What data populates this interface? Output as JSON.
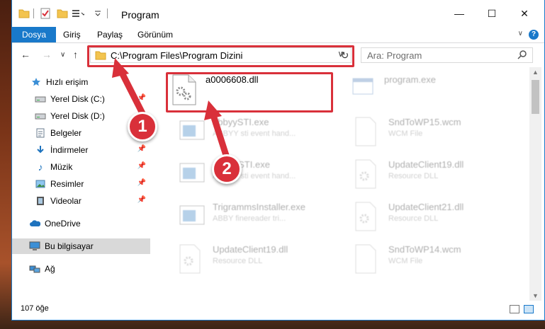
{
  "window": {
    "title": "Program",
    "minimize": "—",
    "maximize": "☐",
    "close": "✕"
  },
  "ribbon": {
    "tabs": [
      "Dosya",
      "Giriş",
      "Paylaş",
      "Görünüm"
    ],
    "help": "?"
  },
  "nav": {
    "address": "C:\\Program Files\\Program Dizini",
    "search_placeholder": "Ara: Program"
  },
  "sidebar": {
    "items": [
      {
        "label": "Hızlı erişim",
        "icon": "star-icon"
      },
      {
        "label": "Yerel Disk (C:)",
        "icon": "drive-icon"
      },
      {
        "label": "Yerel Disk (D:)",
        "icon": "drive-icon"
      },
      {
        "label": "Belgeler",
        "icon": "documents-icon"
      },
      {
        "label": "İndirmeler",
        "icon": "download-icon"
      },
      {
        "label": "Müzik",
        "icon": "music-icon"
      },
      {
        "label": "Resimler",
        "icon": "pictures-icon"
      },
      {
        "label": "Videolar",
        "icon": "video-icon"
      },
      {
        "label": "OneDrive",
        "icon": "cloud-icon"
      },
      {
        "label": "Bu bilgisayar",
        "icon": "computer-icon"
      },
      {
        "label": "Ağ",
        "icon": "network-icon"
      }
    ]
  },
  "files": [
    {
      "name": "a0006608.dll",
      "desc": ""
    },
    {
      "name": "program.exe",
      "desc": ""
    },
    {
      "name": "abbyySTI.exe",
      "desc": "ABBYY sti event hand..."
    },
    {
      "name": "SndToWP15.wcm",
      "desc": "WCM File"
    },
    {
      "name": "AbbyySTI.exe",
      "desc": "ABBYY sti event hand..."
    },
    {
      "name": "UpdateClient19.dll",
      "desc": "Resource DLL"
    },
    {
      "name": "TrigrammsInstaller.exe",
      "desc": "ABBY finereader tri..."
    },
    {
      "name": "UpdateClient21.dll",
      "desc": "Resource DLL"
    },
    {
      "name": "UpdateClient19.dll",
      "desc": "Resource DLL"
    },
    {
      "name": "SndToWP14.wcm",
      "desc": "WCM File"
    }
  ],
  "status": {
    "count": "107 öğe"
  },
  "annotations": {
    "step1": "1",
    "step2": "2",
    "color": "#d9303a"
  }
}
